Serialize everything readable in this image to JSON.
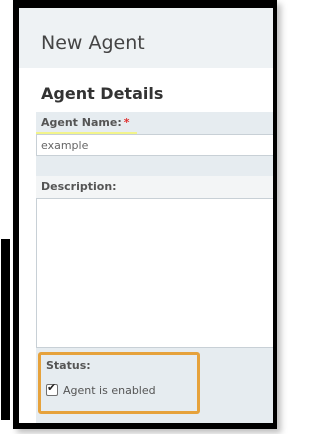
{
  "window": {
    "title": "New Agent"
  },
  "section": {
    "heading": "Agent Details"
  },
  "agent_name": {
    "label": "Agent Name:",
    "required_marker": "*",
    "value": "example"
  },
  "description": {
    "label": "Description:",
    "value": ""
  },
  "status": {
    "label": "Status:",
    "checkbox_label": "Agent is enabled",
    "checked": true,
    "check_glyph": "✔"
  },
  "colors": {
    "highlight": "#f6f76a",
    "status_outline": "#e6a23c",
    "required": "#e0312f"
  },
  "icons": {
    "required_marker": "asterisk",
    "checkbox": "checkmark-icon"
  }
}
